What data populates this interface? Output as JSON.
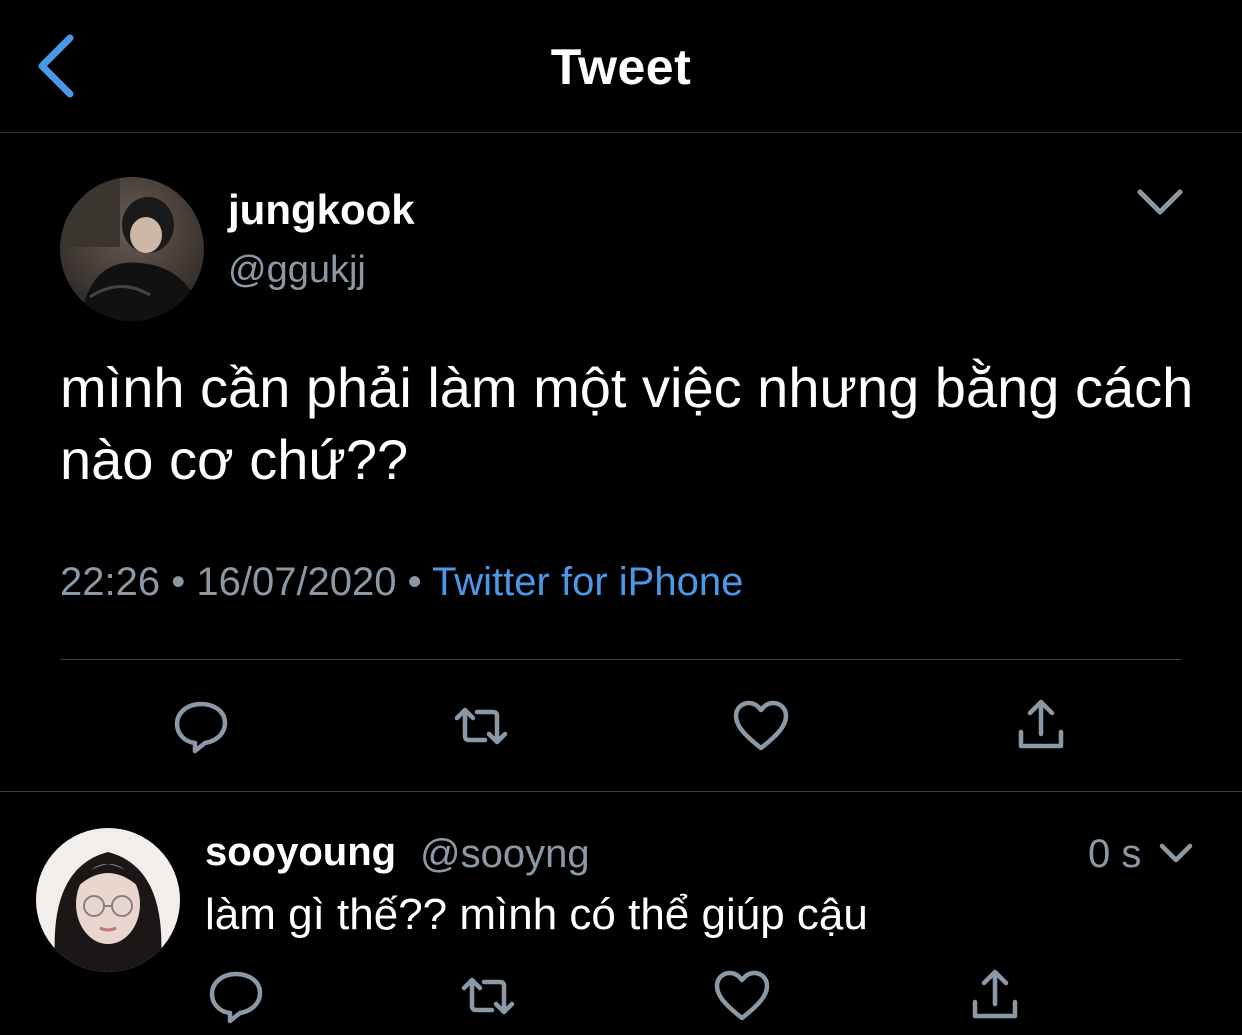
{
  "header": {
    "title": "Tweet",
    "back_icon": "chevron-left-icon"
  },
  "tweet": {
    "display_name": "jungkook",
    "handle": "@ggukjj",
    "text": "mình cần phải làm một việc nhưng bằng cách nào cơ chứ??",
    "time": "22:26",
    "date": "16/07/2020",
    "separator": " • ",
    "source": "Twitter for iPhone",
    "actions": [
      "reply-icon",
      "retweet-icon",
      "like-icon",
      "share-icon"
    ]
  },
  "reply": {
    "display_name": "sooyoung",
    "handle": "@sooyng",
    "time": "0 s",
    "text": "làm gì thế?? mình có thể giúp cậu",
    "actions": [
      "reply-icon",
      "retweet-icon",
      "like-icon",
      "share-icon"
    ]
  },
  "colors": {
    "background": "#000000",
    "text": "#ffffff",
    "muted": "#8b98a5",
    "accent": "#4a99e9",
    "divider": "#3a3f44"
  }
}
